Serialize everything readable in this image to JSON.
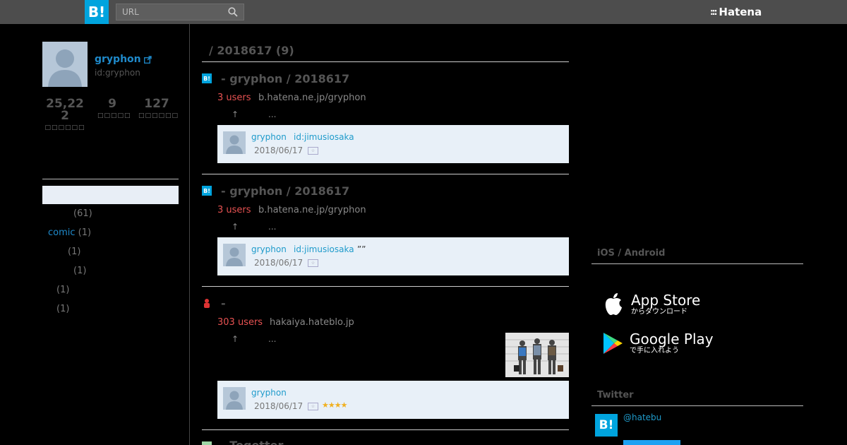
{
  "header": {
    "logo_text": "B!",
    "search_placeholder": "URL",
    "brand_name": "Hatena",
    "brand_mark": ":::"
  },
  "profile": {
    "name": "gryphon",
    "id_text": "id:gryphon",
    "stats": [
      {
        "value_line1": "25,22",
        "value_line2": "2",
        "label": "□□□□□□"
      },
      {
        "value_line1": "9",
        "value_line2": "",
        "label": "□□□□□"
      },
      {
        "value_line1": "127",
        "value_line2": "",
        "label": "□□□□□□"
      }
    ]
  },
  "categories": [
    {
      "name": "",
      "count": "(61)"
    },
    {
      "name": "comic",
      "count": "(1)"
    },
    {
      "name": "",
      "count": "(1)"
    },
    {
      "name": "",
      "count": "(1)"
    },
    {
      "name": "",
      "count": "(1)"
    },
    {
      "name": "",
      "count": "(1)"
    }
  ],
  "main": {
    "title": "/ 2018617 (9)",
    "entries": [
      {
        "title": "- gryphon / 2018617",
        "users": "3 users",
        "domain": "b.hatena.ne.jp/gryphon",
        "arrow": "↑",
        "ellipsis": "...",
        "comment": {
          "user": "gryphon",
          "id": "id:jimusiosaka",
          "quote": "",
          "date": "2018/06/17",
          "stars": ""
        }
      },
      {
        "title": "- gryphon / 2018617",
        "users": "3 users",
        "domain": "b.hatena.ne.jp/gryphon",
        "arrow": "↑",
        "ellipsis": "...",
        "comment": {
          "user": "gryphon",
          "id": "id:jimusiosaka",
          "quote": "””",
          "date": "2018/06/17",
          "stars": ""
        }
      },
      {
        "title": "-",
        "users": "303 users",
        "domain": "hakaiya.hateblo.jp",
        "arrow": "↑",
        "ellipsis": "...",
        "comment": {
          "user": "gryphon",
          "id": "",
          "quote": "",
          "date": "2018/06/17",
          "stars": "★★★★"
        }
      }
    ],
    "next_title": "- Togetter"
  },
  "right": {
    "apps_title": "iOS / Android",
    "app_store": {
      "big": "App Store",
      "small": "からダウンロード"
    },
    "google_play": {
      "big": "Google Play",
      "small": "で手に入れよう"
    },
    "twitter_title": "Twitter",
    "twitter_handle": "@hatebu",
    "twitter_logo": "B!"
  },
  "colors": {
    "accent": "#00a4de",
    "link": "#1f8acb",
    "users_red": "#e75252",
    "comment_bg": "#e8f0f8"
  }
}
